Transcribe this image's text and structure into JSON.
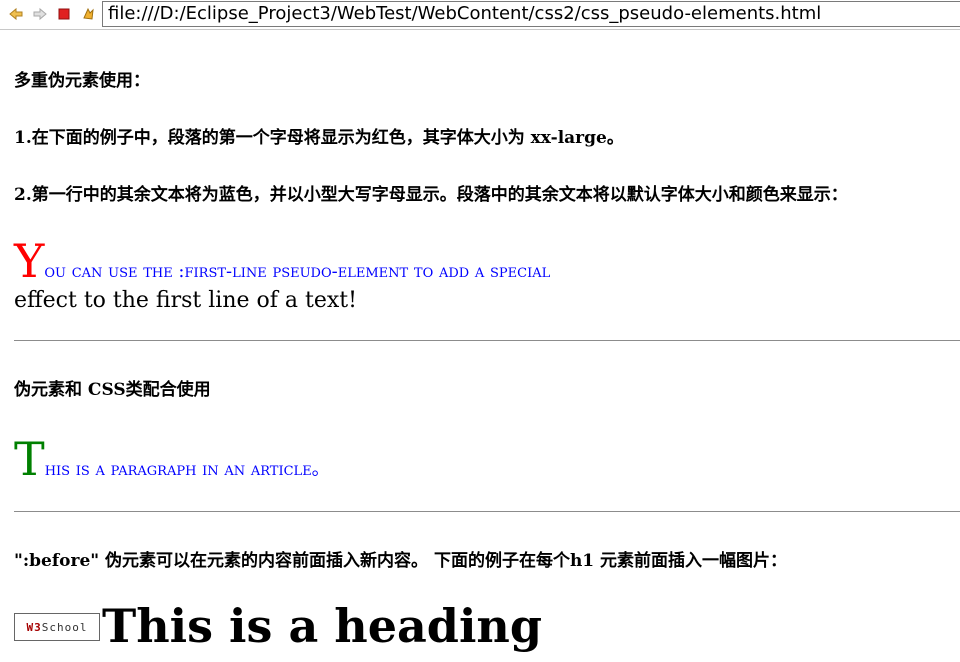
{
  "browser": {
    "url": "file:///D:/Eclipse_Project3/WebTest/WebContent/css2/css_pseudo-elements.html",
    "back_icon": "back-arrow-icon",
    "forward_icon": "forward-arrow-icon",
    "stop_icon": "stop-icon",
    "refresh_icon": "refresh-icon"
  },
  "page": {
    "intro_heading": "多重伪元素使用：",
    "intro_point1": "1.在下面的例子中，段落的第一个字母将显示为红色，其字体大小为 xx-large。",
    "intro_point2": "2.第一行中的其余文本将为蓝色，并以小型大写字母显示。段落中的其余文本将以默认字体大小和颜色来显示：",
    "example1": {
      "first_letter": "Y",
      "first_line_rest": "ou can use the :first-line pseudo-element to add a special",
      "second_line": "effect to the first line of a text!",
      "first_letter_color": "#ff0000",
      "first_line_color": "#0000ff"
    },
    "css_class_heading": "伪元素和 CSS类配合使用",
    "example2": {
      "first_letter": "T",
      "first_line_rest": "his is a paragraph in an article。",
      "first_letter_color": "#008000",
      "first_line_color": "#0000ff"
    },
    "before_note": "\":before\" 伪元素可以在元素的内容前面插入新内容。 下面的例子在每个h1 元素前面插入一幅图片：",
    "logo": {
      "w3": "W3",
      "school": "School"
    },
    "heading": "This is a heading"
  }
}
